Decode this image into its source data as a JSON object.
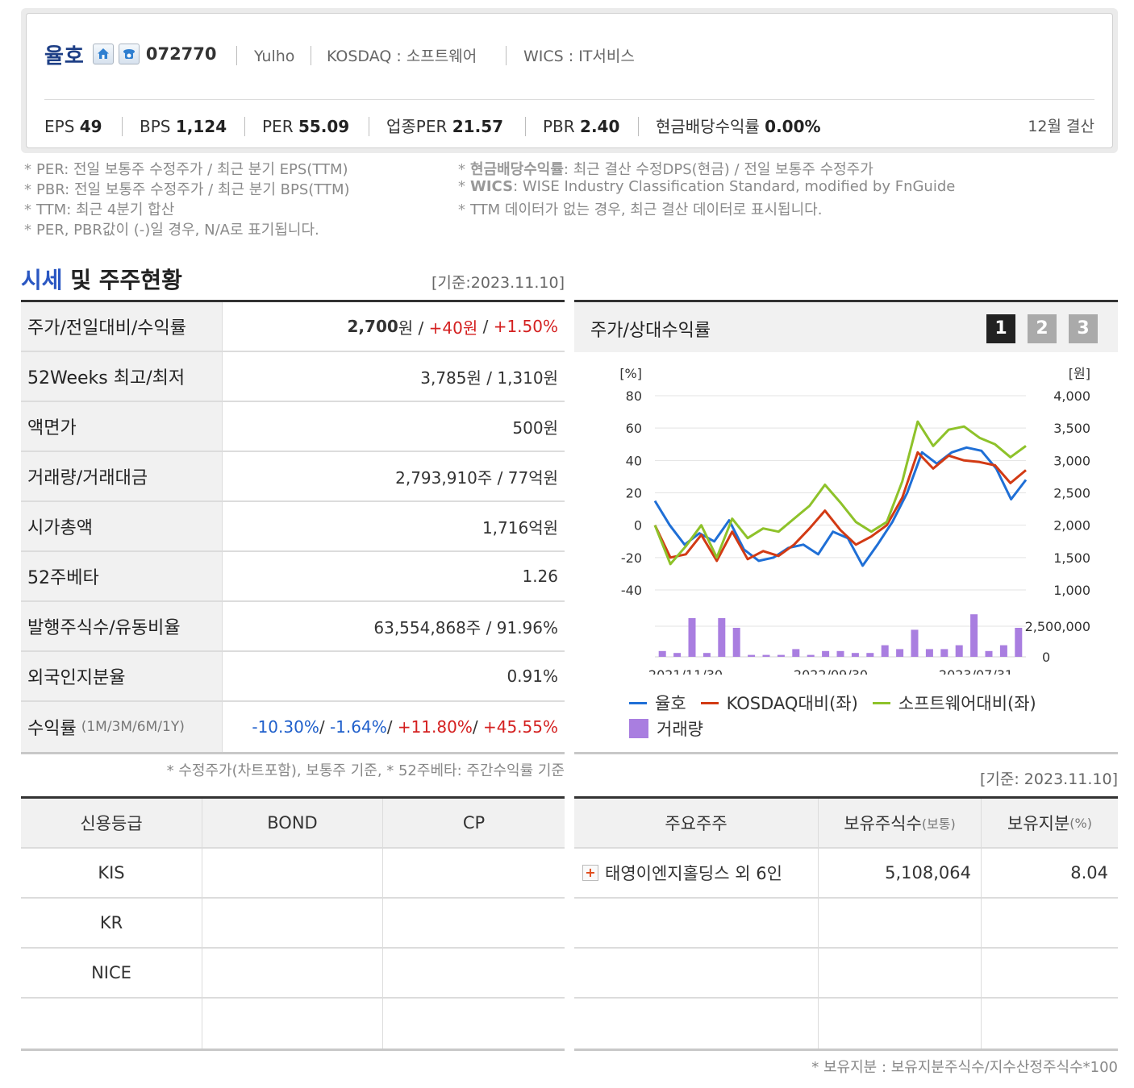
{
  "company": {
    "name": "율호",
    "code": "072770",
    "eng_name": "Yulho",
    "market": "KOSDAQ : 소프트웨어",
    "wics": "WICS : IT서비스",
    "settle": "12월 결산"
  },
  "ratios": [
    {
      "label": "EPS",
      "value": "49"
    },
    {
      "label": "BPS",
      "value": "1,124"
    },
    {
      "label": "PER",
      "value": "55.09"
    },
    {
      "label": "업종PER",
      "value": "21.57"
    },
    {
      "label": "PBR",
      "value": "2.40"
    },
    {
      "label": "현금배당수익률",
      "value": "0.00%"
    }
  ],
  "notes_left": [
    {
      "key": "PER",
      "text": ": 전일 보통주 수정주가 / 최근 분기 EPS(TTM)"
    },
    {
      "key": "PBR",
      "text": ": 전일 보통주 수정주가 / 최근 분기 BPS(TTM)"
    },
    {
      "key": "TTM",
      "text": ": 최근 4분기 합산"
    },
    {
      "key": "",
      "text": "PER, PBR값이 (-)일 경우, N/A로 표기됩니다."
    }
  ],
  "notes_right": [
    {
      "key": "현금배당수익률",
      "text": ": 최근 결산 수정DPS(현금) / 전일 보통주 수정주가"
    },
    {
      "key": "WICS",
      "text": ": WISE Industry Classification Standard, modified by FnGuide"
    },
    {
      "key": "",
      "text": "TTM 데이터가 없는 경우, 최근 결산 데이터로 표시됩니다."
    }
  ],
  "section": {
    "title_blue": "시세",
    "title_rest": " 및 주주현황",
    "base_date": "[기준:2023.11.10]",
    "base_date2": "[기준: 2023.11.10]"
  },
  "price_table": [
    {
      "label": "주가/전일대비/수익률",
      "value_parts": [
        {
          "t": "2,700",
          "c": "bold"
        },
        {
          "t": "원 / ",
          "c": ""
        },
        {
          "t": "+40원",
          "c": "up"
        },
        {
          "t": " / ",
          "c": ""
        },
        {
          "t": "+1.50%",
          "c": "up"
        }
      ]
    },
    {
      "label": "52Weeks 최고/최저",
      "value_parts": [
        {
          "t": "3,785원 / 1,310원",
          "c": ""
        }
      ]
    },
    {
      "label": "액면가",
      "value_parts": [
        {
          "t": "500원",
          "c": ""
        }
      ]
    },
    {
      "label": "거래량/거래대금",
      "value_parts": [
        {
          "t": "2,793,910주 / 77억원",
          "c": ""
        }
      ]
    },
    {
      "label": "시가총액",
      "value_parts": [
        {
          "t": "1,716억원",
          "c": ""
        }
      ]
    },
    {
      "label": "52주베타",
      "value_parts": [
        {
          "t": "1.26",
          "c": ""
        }
      ]
    },
    {
      "label": "발행주식수/유동비율",
      "value_parts": [
        {
          "t": "63,554,868주 / 91.96%",
          "c": ""
        }
      ]
    },
    {
      "label": "외국인지분율",
      "value_parts": [
        {
          "t": "0.91%",
          "c": ""
        }
      ]
    },
    {
      "label": "수익률",
      "sublabel": "(1M/3M/6M/1Y)",
      "value_parts": [
        {
          "t": "-10.30%",
          "c": "dn"
        },
        {
          "t": "/ ",
          "c": ""
        },
        {
          "t": "-1.64%",
          "c": "dn"
        },
        {
          "t": "/ ",
          "c": ""
        },
        {
          "t": "+11.80%",
          "c": "up"
        },
        {
          "t": "/ ",
          "c": ""
        },
        {
          "t": "+45.55%",
          "c": "up"
        }
      ]
    }
  ],
  "price_footnote": "* 수정주가(차트포함), 보통주 기준, * 52주베타: 주간수익률 기준",
  "chart_panel": {
    "title": "주가/상대수익률",
    "pages": [
      "1",
      "2",
      "3"
    ]
  },
  "chart_data": {
    "type": "line",
    "title": "",
    "ylabel": "[%]",
    "y2label": "[원]",
    "ylim": [
      -40,
      80
    ],
    "y_ticks": [
      80,
      60,
      40,
      20,
      0,
      -20,
      -40
    ],
    "y2_ticks": [
      "4,000",
      "3,500",
      "3,000",
      "2,500",
      "2,000",
      "1,500",
      "1,000"
    ],
    "vol_ticks": [
      "2,500,000",
      "0"
    ],
    "x_labels": [
      "2021/11/30",
      "2022/09/30",
      "2023/07/31"
    ],
    "series": [
      {
        "name": "율호",
        "color": "#1f6fd6",
        "values": [
          15,
          0,
          -12,
          -5,
          -10,
          3,
          -15,
          -22,
          -20,
          -14,
          -12,
          -18,
          -4,
          -8,
          -25,
          -12,
          2,
          20,
          45,
          38,
          45,
          48,
          46,
          35,
          16,
          28
        ]
      },
      {
        "name": "KOSDAQ대비(좌)",
        "color": "#d23a14",
        "values": [
          0,
          -20,
          -18,
          -6,
          -22,
          -4,
          -21,
          -16,
          -19,
          -12,
          -2,
          9,
          -3,
          -12,
          -7,
          0,
          17,
          45,
          35,
          43,
          40,
          39,
          37,
          26,
          34
        ]
      },
      {
        "name": "소프트웨어대비(좌)",
        "color": "#8ec22a",
        "values": [
          0,
          -24,
          -13,
          0,
          -20,
          4,
          -8,
          -2,
          -4,
          4,
          12,
          25,
          14,
          2,
          -4,
          2,
          27,
          64,
          49,
          59,
          61,
          54,
          50,
          42,
          49
        ]
      }
    ],
    "volume": {
      "name": "거래량",
      "color": "#a97ee0",
      "values": [
        3,
        2,
        20,
        2,
        20,
        15,
        1,
        1,
        1,
        4,
        1,
        3,
        3,
        2,
        2,
        6,
        4,
        14,
        4,
        4,
        6,
        22,
        3,
        6,
        15
      ]
    }
  },
  "credit_table": {
    "headers": [
      "신용등급",
      "BOND",
      "CP"
    ],
    "rows": [
      [
        "KIS",
        "",
        ""
      ],
      [
        "KR",
        "",
        ""
      ],
      [
        "NICE",
        "",
        ""
      ],
      [
        "",
        "",
        ""
      ]
    ]
  },
  "shareholder_table": {
    "headers": [
      {
        "main": "주요주주",
        "sub": ""
      },
      {
        "main": "보유주식수",
        "sub": "(보통)"
      },
      {
        "main": "보유지분",
        "sub": "(%)"
      }
    ],
    "rows": [
      {
        "name": "태영이엔지홀딩스 외 6인",
        "shares": "5,108,064",
        "pct": "8.04"
      },
      {
        "name": "",
        "shares": "",
        "pct": ""
      },
      {
        "name": "",
        "shares": "",
        "pct": ""
      },
      {
        "name": "",
        "shares": "",
        "pct": ""
      }
    ],
    "footnote": "* 보유지분 : 보유지분주식수/지수산정주식수*100"
  }
}
